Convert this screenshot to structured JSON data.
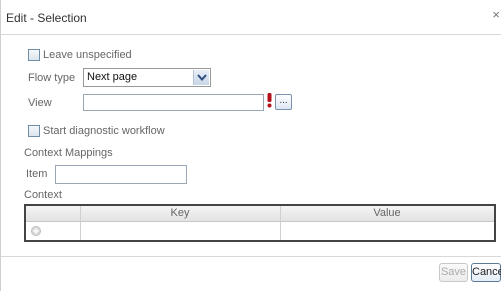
{
  "window": {
    "title": "Edit - Selection",
    "close_glyph": "×"
  },
  "form": {
    "leave_unspecified": {
      "label": "Leave unspecified",
      "checked": false
    },
    "flow_type": {
      "label": "Flow type",
      "selected": "Next page"
    },
    "view": {
      "label": "View",
      "value": "",
      "browse_label": "..."
    },
    "start_diagnostic": {
      "label": "Start diagnostic workflow",
      "checked": false
    },
    "context_mappings": {
      "heading": "Context Mappings",
      "item_label": "Item",
      "item_value": ""
    },
    "context": {
      "heading": "Context",
      "columns": [
        "Key",
        "Value"
      ],
      "rows": []
    }
  },
  "footer": {
    "save_label": "Save",
    "cancel_label": "Cancel"
  },
  "icons": [
    "close-icon",
    "chevron-down-icon",
    "required-marker-icon",
    "add-row-icon"
  ]
}
